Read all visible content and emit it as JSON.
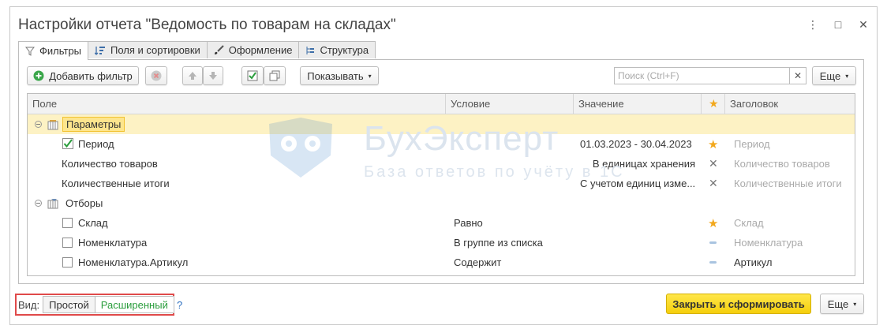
{
  "window": {
    "title": "Настройки отчета \"Ведомость по товарам на складах\""
  },
  "tabs": [
    {
      "label": "Фильтры",
      "icon": "filter-icon"
    },
    {
      "label": "Поля и сортировки",
      "icon": "sort-icon"
    },
    {
      "label": "Оформление",
      "icon": "brush-icon"
    },
    {
      "label": "Структура",
      "icon": "structure-icon"
    }
  ],
  "toolbar": {
    "add_filter": "Добавить фильтр",
    "show": "Показывать",
    "search_placeholder": "Поиск (Ctrl+F)",
    "more": "Еще"
  },
  "columns": {
    "field": "Поле",
    "condition": "Условие",
    "value": "Значение",
    "header": "Заголовок"
  },
  "rows": [
    {
      "field": "Параметры",
      "condition": "",
      "value": "",
      "header": ""
    },
    {
      "field": "Период",
      "condition": "",
      "value": "01.03.2023 - 30.04.2023",
      "header": "Период"
    },
    {
      "field": "Количество товаров",
      "condition": "",
      "value": "В единицах хранения",
      "header": "Количество товаров"
    },
    {
      "field": "Количественные итоги",
      "condition": "",
      "value": "С учетом единиц изме...",
      "header": "Количественные итоги"
    },
    {
      "field": "Отборы",
      "condition": "",
      "value": "",
      "header": ""
    },
    {
      "field": "Склад",
      "condition": "Равно",
      "value": "",
      "header": "Склад"
    },
    {
      "field": "Номенклатура",
      "condition": "В группе из списка",
      "value": "",
      "header": "Номенклатура"
    },
    {
      "field": "Номенклатура.Артикул",
      "condition": "Содержит",
      "value": "",
      "header": "Артикул"
    }
  ],
  "watermark": {
    "title": "БухЭксперт",
    "subtitle": "База ответов по учёту в 1С"
  },
  "bottom": {
    "view_label": "Вид:",
    "simple": "Простой",
    "advanced": "Расширенный",
    "help": "?",
    "close_generate": "Закрыть и сформировать",
    "more": "Еще"
  },
  "colors": {
    "accent_yellow": "#f5cf0c",
    "selection": "#fdf2c4",
    "star": "#f2a81d",
    "highlight_red": "#e04a4a",
    "green": "#2a9d3c"
  }
}
